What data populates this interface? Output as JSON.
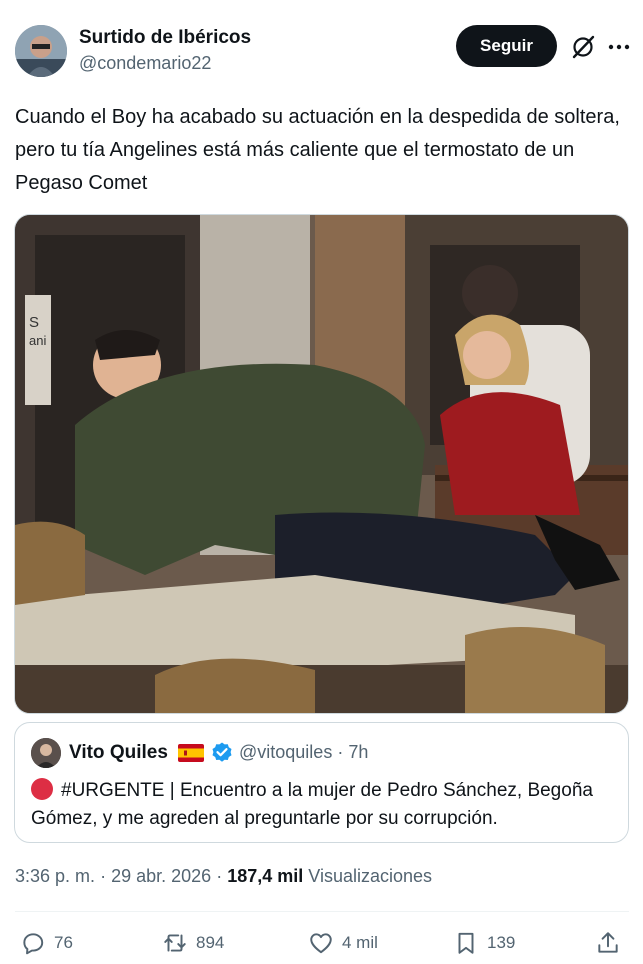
{
  "author": {
    "display_name": "Surtido de Ibéricos",
    "handle": "@condemario22",
    "avatar_icon": "profile-photo"
  },
  "follow_label": "Seguir",
  "tweet_text": "Cuando el Boy ha acabado su actuación en la despedida de soltera, pero tu tía Angelines está más caliente que el termostato de un Pegaso Comet",
  "media": {
    "sign_text": "S\nanis"
  },
  "quoted": {
    "display_name": "Vito Quiles",
    "handle": "@vitoquiles",
    "separator": "·",
    "time": "7h",
    "text_tag": "#URGENTE",
    "text_rest": " | Encuentro a la mujer de Pedro Sánchez, Begoña Gómez, y me agreden al preguntarle por su corrupción."
  },
  "meta": {
    "time": "3:36 p. m.",
    "dot": "·",
    "date": "29 abr. 2026",
    "dot2": "·",
    "views_count": "187,4 mil",
    "views_label": "Visualizaciones"
  },
  "actions": {
    "replies": "76",
    "reposts": "894",
    "likes": "4 mil",
    "bookmarks": "139"
  },
  "colors": {
    "text": "#0f1419",
    "secondary": "#536471",
    "verified": "#1d9bf0",
    "border": "#cfd9de"
  }
}
